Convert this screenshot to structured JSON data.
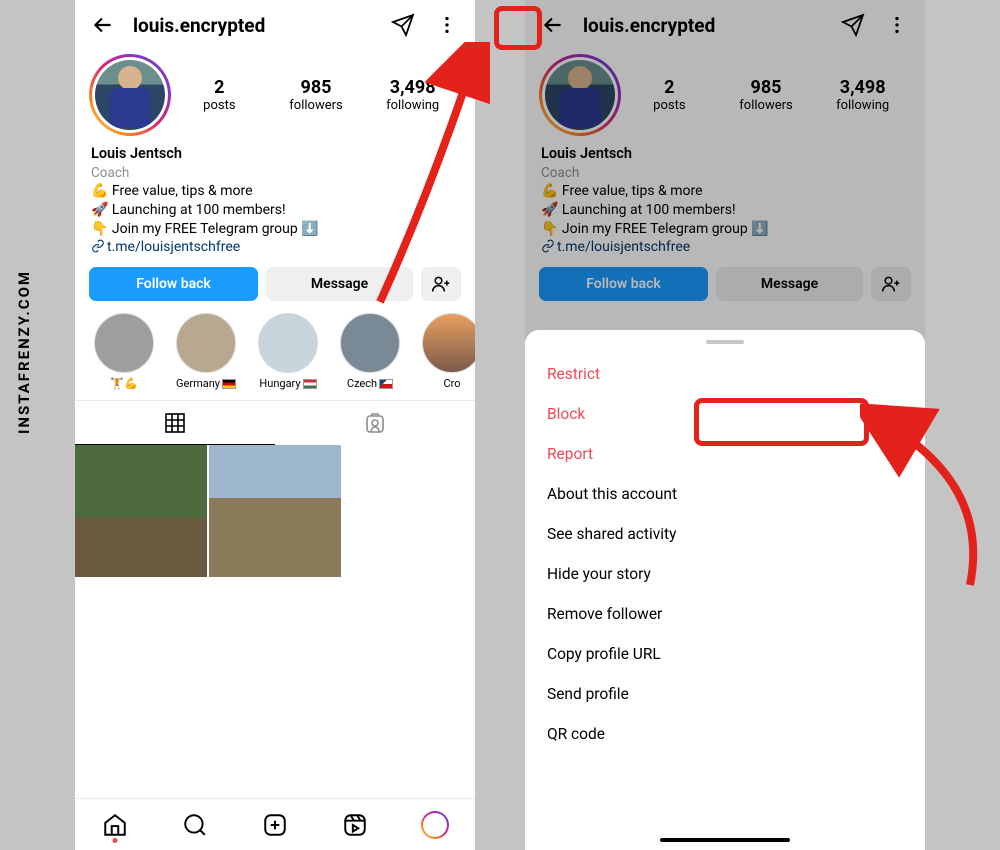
{
  "watermark": "INSTAFRENZY.COM",
  "profile": {
    "username": "louis.encrypted",
    "posts_count": "2",
    "posts_label": "posts",
    "followers_count": "985",
    "followers_label": "followers",
    "following_count": "3,498",
    "following_label": "following",
    "display_name": "Louis Jentsch",
    "category": "Coach",
    "bio_line1": "💪 Free value, tips & more",
    "bio_line2": "🚀 Launching at 100 members!",
    "bio_line3": "👇 Join my FREE Telegram group ⬇️",
    "link_text": "t.me/louisjentschfree"
  },
  "buttons": {
    "follow_back": "Follow back",
    "message": "Message"
  },
  "highlights": [
    {
      "label": "🏋️💪"
    },
    {
      "label": "Germany",
      "flag": "de"
    },
    {
      "label": "Hungary",
      "flag": "hu"
    },
    {
      "label": "Czech",
      "flag": "cz"
    },
    {
      "label": "Cro"
    }
  ],
  "menu": {
    "restrict": "Restrict",
    "block": "Block",
    "report": "Report",
    "about": "About this account",
    "shared": "See shared activity",
    "hide_story": "Hide your story",
    "remove_follower": "Remove follower",
    "copy_url": "Copy profile URL",
    "send_profile": "Send profile",
    "qr": "QR code"
  }
}
